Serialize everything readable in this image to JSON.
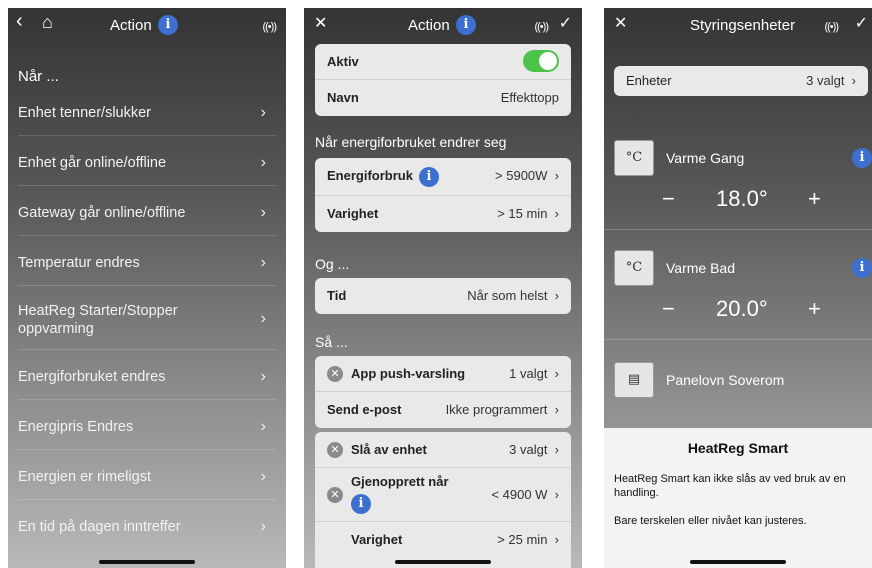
{
  "screen1": {
    "title": "Action",
    "back": "‹",
    "home": "⌂",
    "info": "i",
    "signal": "((•))",
    "section": "Når ...",
    "items": [
      "Enhet tenner/slukker",
      "Enhet går online/offline",
      "Gateway går online/offline",
      "Temperatur endres",
      "HeatReg Starter/Stopper oppvarming",
      "Energiforbruket endres",
      "Energipris Endres",
      "Energien er rimeligst",
      "En tid på dagen inntreffer"
    ]
  },
  "screen2": {
    "title": "Action",
    "close": "✕",
    "check": "✓",
    "info": "i",
    "signal": "((•))",
    "card1": {
      "aktiv_label": "Aktiv",
      "navn_label": "Navn",
      "navn_value": "Effekttopp",
      "aktiv_on": true
    },
    "when_header": "Når energiforbruket endrer seg",
    "card2": {
      "energi_label": "Energiforbruk",
      "energi_value": "> 5900W",
      "varighet_label": "Varighet",
      "varighet_value": "> 15 min"
    },
    "og_header": "Og ...",
    "card3": {
      "tid_label": "Tid",
      "tid_value": "Når som helst"
    },
    "sa_header": "Så ...",
    "card4": {
      "push_label": "App push-varsling",
      "push_value": "1 valgt",
      "epost_label": "Send e-post",
      "epost_value": "Ikke programmert"
    },
    "card5": {
      "sla_label": "Slå av enhet",
      "sla_value": "3 valgt",
      "gjen_label": "Gjenopprett når",
      "gjen_value": "< 4900 W",
      "var_label": "Varighet",
      "var_value": "> 25 min"
    },
    "chev": "›"
  },
  "screen3": {
    "title": "Styringsenheter",
    "close": "✕",
    "check": "✓",
    "signal": "((•))",
    "enheter_label": "Enheter",
    "enheter_value": "3 valgt",
    "chev": "›",
    "devices": [
      {
        "name": "Varme Gang",
        "temp": "18.0°"
      },
      {
        "name": "Varme Bad",
        "temp": "20.0°"
      },
      {
        "name": "Panelovn Soverom"
      }
    ],
    "minus": "−",
    "plus": "+",
    "info": "i",
    "sheet_title": "HeatReg Smart",
    "sheet_text1": "HeatReg Smart kan ikke slås av ved bruk av en handling.",
    "sheet_text2": "Bare terskelen eller nivået kan justeres."
  }
}
